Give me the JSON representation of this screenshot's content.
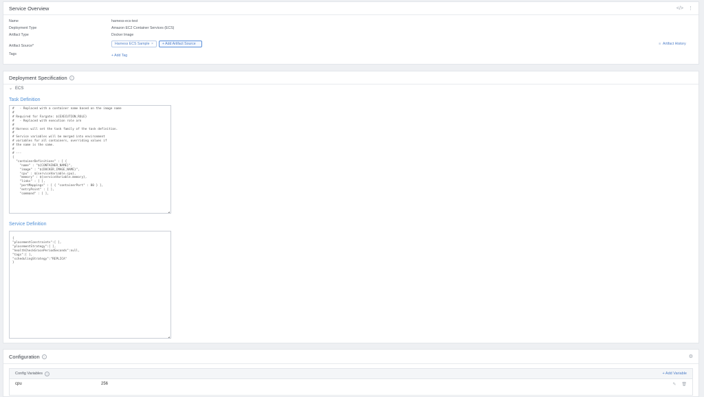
{
  "overview": {
    "title": "Service Overview",
    "rows": [
      {
        "label": "Name",
        "value": "harness-ecs-test"
      },
      {
        "label": "Deployment Type",
        "value": "Amazon EC2 Container Services (ECS)"
      },
      {
        "label": "Artifact Type",
        "value": "Docker Image"
      },
      {
        "label": "Artifact Source*",
        "value": ""
      },
      {
        "label": "Tags",
        "value": ""
      }
    ],
    "artifact_chip": "Harness ECS Sample",
    "add_artifact_source": "+ Add Artifact Source",
    "artifact_history": "Artifact History",
    "add_tag": "+ Add Tag",
    "icons": {
      "code": "</>",
      "menu": "⋮"
    }
  },
  "deployment": {
    "title": "Deployment Specification",
    "ecs_label": "ECS",
    "task_definition_label": "Task Definition",
    "task_definition_text": "#   - Replaced with a container name based on the image name\n#\n# Required for Fargate: ${EXECUTION_ROLE}\n#   - Replaced with execution role arn\n#\n# Harness will set the task family of the task definition.\n#\n# Service variables will be merged into environment\n# variables for all containers, overriding values if\n# the name is the same.\n#\n# ---\n{\n  \"containerDefinitions\" : [ {\n    \"name\" : \"${CONTAINER_NAME}\",\n    \"image\" : \"${DOCKER_IMAGE_NAME}\",\n    \"cpu\" : ${serviceVariable.cpu},\n    \"memory\" : ${serviceVariable.memory},\n    \"links\" : [ ],\n    \"portMappings\" : [ { \"containerPort\" : 80 } ],\n    \"entryPoint\" : [ ],\n    \"command\" : [ ],",
    "service_definition_label": "Service Definition",
    "service_definition_text": "{\n\"placementConstraints\":[ ],\n\"placementStrategy\":[ ],\n\"healthCheckGracePeriodSeconds\":null,\n\"tags\":[ ],\n\"schedulingStrategy\":\"REPLICA\"\n}"
  },
  "configuration": {
    "title": "Configuration",
    "config_variables_label": "Config Variables",
    "add_variable": "+ Add Variable",
    "variables": [
      {
        "name": "cpu",
        "value": "256"
      }
    ]
  }
}
